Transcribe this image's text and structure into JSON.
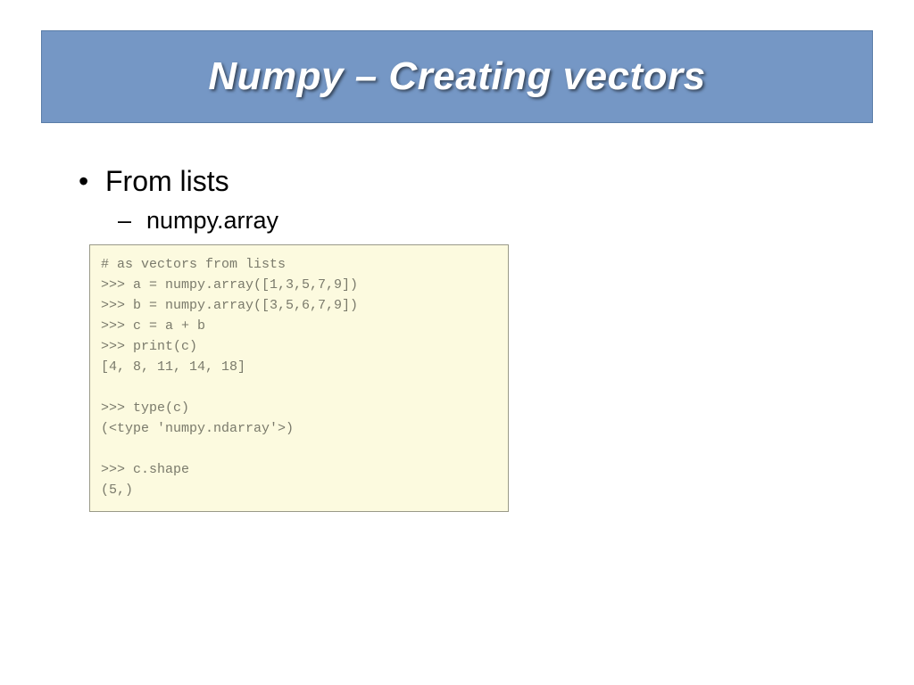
{
  "title": "Numpy – Creating vectors",
  "bullets": {
    "level1": "From lists",
    "level2": "numpy.array"
  },
  "code": "# as vectors from lists\n>>> a = numpy.array([1,3,5,7,9])\n>>> b = numpy.array([3,5,6,7,9])\n>>> c = a + b\n>>> print(c)\n[4, 8, 11, 14, 18]\n\n>>> type(c)\n(<type 'numpy.ndarray'>)\n\n>>> c.shape\n(5,)"
}
